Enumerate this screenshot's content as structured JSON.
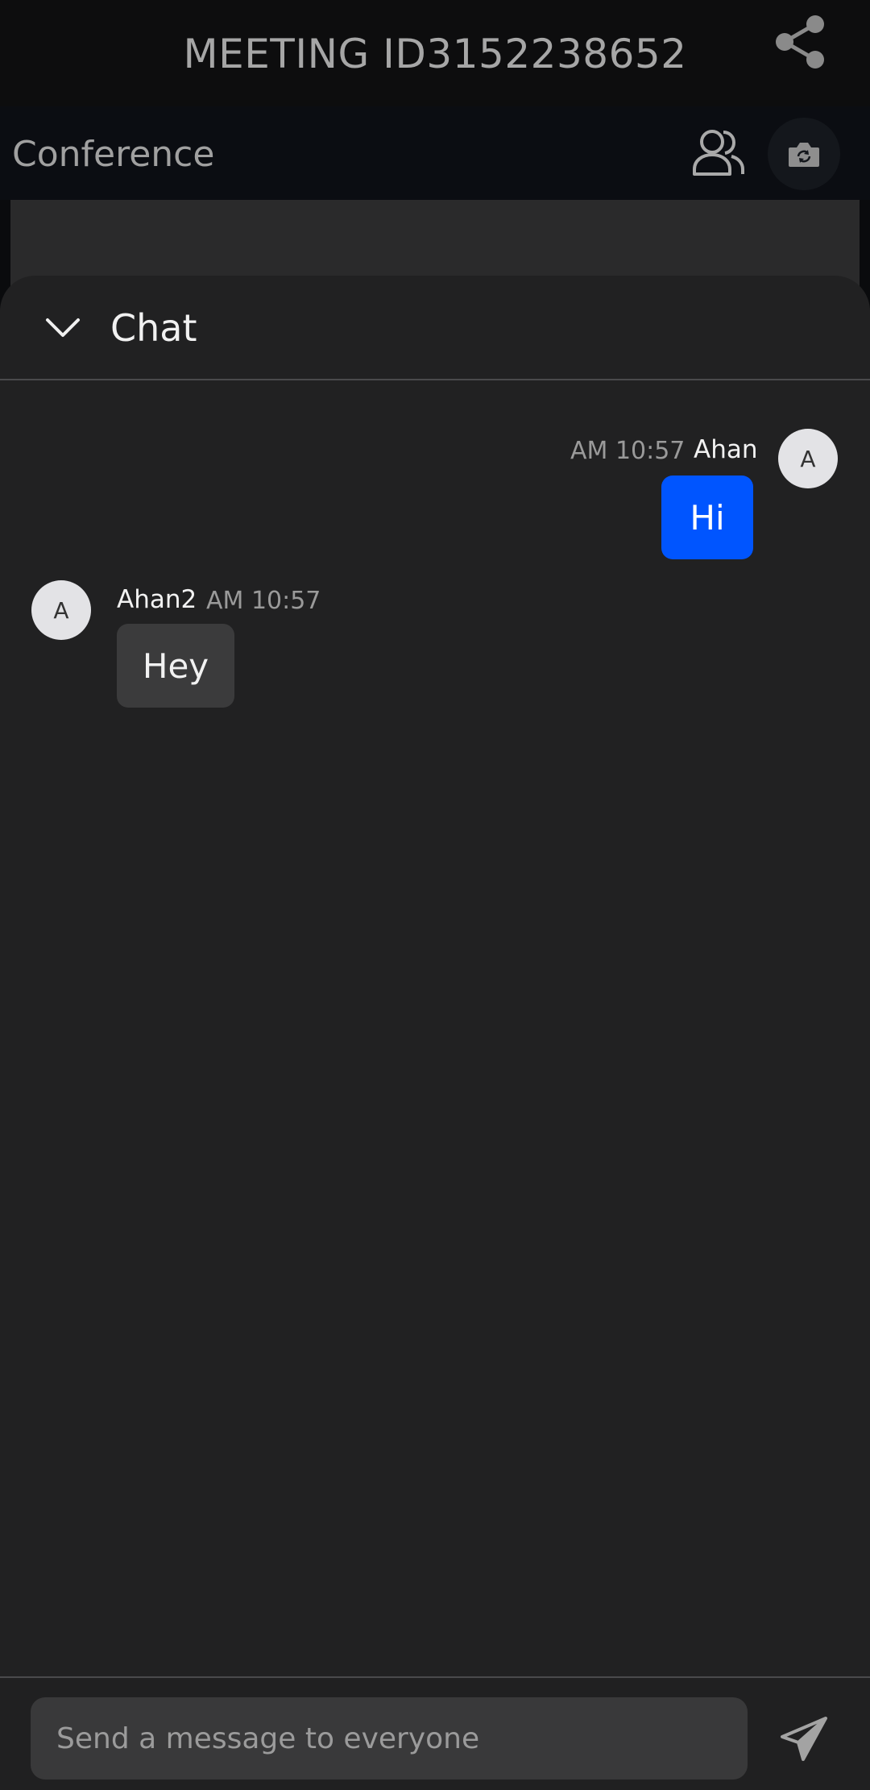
{
  "meeting_bar": {
    "title": "MEETING ID3152238652",
    "share_icon": "share-icon"
  },
  "conference_bar": {
    "title": "Conference",
    "participants_icon": "participants-icon",
    "camera_icon": "camera-switch-icon"
  },
  "chat": {
    "title": "Chat",
    "collapse_icon": "chevron-down-icon",
    "messages": [
      {
        "direction": "outgoing",
        "sender": "Ahan",
        "time": "AM 10:57",
        "text": "Hi",
        "avatar_initial": "A"
      },
      {
        "direction": "incoming",
        "sender": "Ahan2",
        "time": "AM 10:57",
        "text": "Hey",
        "avatar_initial": "A"
      }
    ],
    "composer": {
      "placeholder": "Send a message to everyone",
      "value": "",
      "send_icon": "send-icon"
    }
  },
  "colors": {
    "outgoing_bubble": "#0055ff",
    "incoming_bubble": "#3b3b3c",
    "sheet_background": "#212122"
  }
}
